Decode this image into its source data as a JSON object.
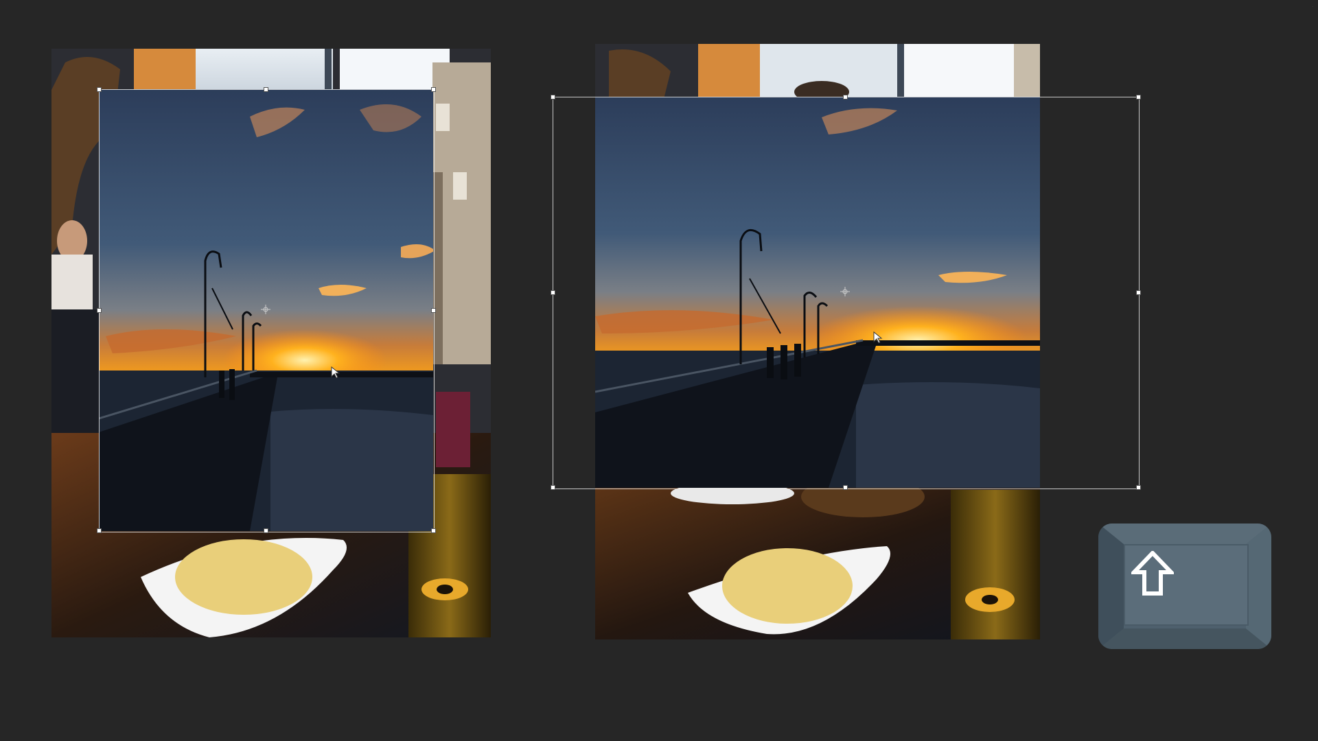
{
  "app": {
    "title": ""
  },
  "colors": {
    "canvas_background": "#262626",
    "transform_box": "#e6e6e6",
    "shift_key": "#4e606d",
    "shift_key_face": "#5b6d7a"
  },
  "icons": {
    "shift_key": "up-arrow-icon",
    "move_cursor": "pointer-cursor-icon",
    "center_marker": "crosshair-icon"
  },
  "left_panel": {
    "scene_image": "restaurant-table-photo",
    "placed_image": "pier-sunset-photo",
    "state": "before-transform"
  },
  "right_panel": {
    "scene_image": "restaurant-table-photo",
    "placed_image": "pier-sunset-photo",
    "state": "after-transform"
  },
  "keyboard_hint": {
    "key": "shift",
    "icon": "up-arrow-icon"
  }
}
